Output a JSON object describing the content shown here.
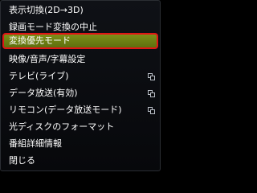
{
  "menu": {
    "items": [
      {
        "label": "表示切換(2D→3D)",
        "submenu": false
      },
      {
        "label": "録画モード変換の中止",
        "submenu": false
      },
      {
        "label": "変換優先モード",
        "submenu": false,
        "selected": true
      },
      {
        "label": "映像/音声/字幕設定",
        "submenu": false
      },
      {
        "label": "テレビ(ライブ)",
        "submenu": true
      },
      {
        "label": "データ放送(有効)",
        "submenu": true
      },
      {
        "label": "リモコン(データ放送モード)",
        "submenu": true
      },
      {
        "label": "光ディスクのフォーマット",
        "submenu": false
      },
      {
        "label": "番組詳細情報",
        "submenu": false
      },
      {
        "label": "閉じる",
        "submenu": false
      }
    ]
  },
  "colors": {
    "background": "#0b0c10",
    "highlight": "#6f8013",
    "highlight_border": "#e01515",
    "text": "#ffffff"
  },
  "icons": {
    "submenu": "submenu-icon"
  }
}
